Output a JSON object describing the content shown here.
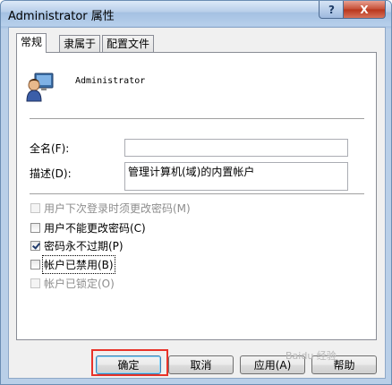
{
  "window": {
    "title": "Administrator 属性"
  },
  "titlebar": {
    "help_label": "?",
    "close_label": "X"
  },
  "tabs": [
    {
      "label": "常规"
    },
    {
      "label": "隶属于"
    },
    {
      "label": "配置文件"
    }
  ],
  "general": {
    "username": "Administrator",
    "fullname_label": "全名(F):",
    "fullname_value": "",
    "description_label": "描述(D):",
    "description_value": "管理计算机(域)的内置帐户",
    "options": [
      {
        "label": "用户下次登录时须更改密码(M)",
        "checked": false,
        "enabled": false
      },
      {
        "label": "用户不能更改密码(C)",
        "checked": false,
        "enabled": true
      },
      {
        "label": "密码永不过期(P)",
        "checked": true,
        "enabled": true
      },
      {
        "label": "帐户已禁用(B)",
        "checked": false,
        "enabled": true
      },
      {
        "label": "帐户已锁定(O)",
        "checked": false,
        "enabled": false
      }
    ]
  },
  "buttons": {
    "ok": "确定",
    "cancel": "取消",
    "apply": "应用(A)",
    "help": "帮助"
  },
  "watermark": "Baidu 经验"
}
